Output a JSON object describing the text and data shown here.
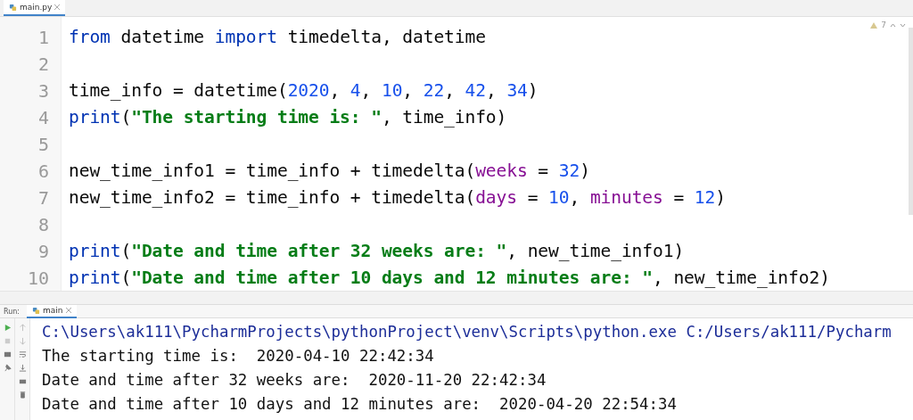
{
  "editor_tab": {
    "label": "main.py",
    "selected": true
  },
  "inspection": {
    "count": "7"
  },
  "code_lines": [
    {
      "number": "1",
      "tokens": [
        {
          "kind": "kw",
          "text": "from"
        },
        {
          "kind": "plain",
          "text": " datetime "
        },
        {
          "kind": "kw",
          "text": "import"
        },
        {
          "kind": "plain",
          "text": " timedelta, datetime"
        }
      ]
    },
    {
      "number": "2"
    },
    {
      "number": "3",
      "tokens": [
        {
          "kind": "plain",
          "text": "time_info = datetime("
        },
        {
          "kind": "num",
          "text": "2020"
        },
        {
          "kind": "plain",
          "text": ", "
        },
        {
          "kind": "num",
          "text": "4"
        },
        {
          "kind": "plain",
          "text": ", "
        },
        {
          "kind": "num",
          "text": "10"
        },
        {
          "kind": "plain",
          "text": ", "
        },
        {
          "kind": "num",
          "text": "22"
        },
        {
          "kind": "plain",
          "text": ", "
        },
        {
          "kind": "num",
          "text": "42"
        },
        {
          "kind": "plain",
          "text": ", "
        },
        {
          "kind": "num",
          "text": "34"
        },
        {
          "kind": "plain",
          "text": ")"
        }
      ]
    },
    {
      "number": "4",
      "tokens": [
        {
          "kind": "kw",
          "text": "print"
        },
        {
          "kind": "plain",
          "text": "("
        },
        {
          "kind": "str",
          "text": "\"The starting time is: \""
        },
        {
          "kind": "plain",
          "text": ", time_info)"
        }
      ]
    },
    {
      "number": "5"
    },
    {
      "number": "6",
      "tokens": [
        {
          "kind": "plain",
          "text": "new_time_info1 = time_info + timedelta("
        },
        {
          "kind": "param",
          "text": "weeks"
        },
        {
          "kind": "plain",
          "text": " = "
        },
        {
          "kind": "num",
          "text": "32"
        },
        {
          "kind": "plain",
          "text": ")"
        }
      ]
    },
    {
      "number": "7",
      "tokens": [
        {
          "kind": "plain",
          "text": "new_time_info2 = time_info + timedelta("
        },
        {
          "kind": "param",
          "text": "days"
        },
        {
          "kind": "plain",
          "text": " = "
        },
        {
          "kind": "num",
          "text": "10"
        },
        {
          "kind": "plain",
          "text": ", "
        },
        {
          "kind": "param",
          "text": "minutes"
        },
        {
          "kind": "plain",
          "text": " = "
        },
        {
          "kind": "num",
          "text": "12"
        },
        {
          "kind": "plain",
          "text": ")"
        }
      ]
    },
    {
      "number": "8"
    },
    {
      "number": "9",
      "tokens": [
        {
          "kind": "kw",
          "text": "print"
        },
        {
          "kind": "plain",
          "text": "("
        },
        {
          "kind": "str",
          "text": "\"Date and time after 32 weeks are: \""
        },
        {
          "kind": "plain",
          "text": ", new_time_info1)"
        }
      ]
    },
    {
      "number": "10",
      "tokens": [
        {
          "kind": "kw",
          "text": "print"
        },
        {
          "kind": "plain",
          "text": "("
        },
        {
          "kind": "str",
          "text": "\"Date and time after 10 days and 12 minutes are: \""
        },
        {
          "kind": "plain",
          "text": ", new_time_info2)"
        }
      ]
    }
  ],
  "run_panel": {
    "label": "Run:",
    "tab": {
      "label": "main",
      "selected": true
    }
  },
  "console_lines": [
    {
      "kind": "command",
      "text": "C:\\Users\\ak111\\PycharmProjects\\pythonProject\\venv\\Scripts\\python.exe C:/Users/ak111/Pycharm"
    },
    {
      "kind": "output",
      "text": "The starting time is:  2020-04-10 22:42:34"
    },
    {
      "kind": "output",
      "text": "Date and time after 32 weeks are:  2020-11-20 22:42:34"
    },
    {
      "kind": "output",
      "text": "Date and time after 10 days and 12 minutes are:  2020-04-20 22:54:34"
    }
  ]
}
